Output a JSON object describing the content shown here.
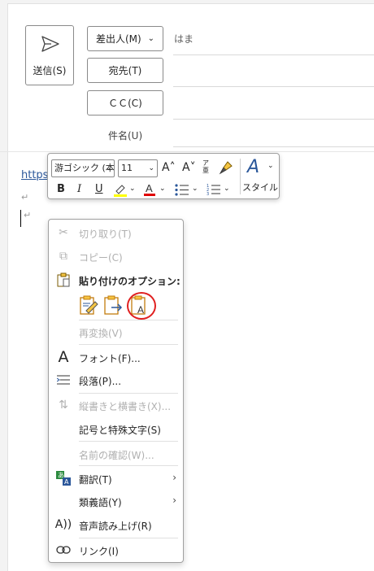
{
  "header": {
    "send_label": "送信(S)",
    "from_label": "差出人(M)",
    "from_value": "はま",
    "to_label": "宛先(T)",
    "cc_label": "ＣＣ(C)",
    "subject_label": "件名(U)"
  },
  "body": {
    "link_text": "https",
    "paragraph_mark": "↵"
  },
  "mini_toolbar": {
    "font_name": "游ゴシック (本",
    "font_size": "11",
    "grow_font": "A˄",
    "shrink_font": "A˅",
    "phonetic": "ア亜",
    "bold": "B",
    "italic": "I",
    "underline": "U",
    "style_label": "スタイル",
    "highlight_color": "#ffff00",
    "font_color": "#e00000"
  },
  "context_menu": {
    "cut": "切り取り(T)",
    "copy": "コピー(C)",
    "paste_options_label": "貼り付けのオプション:",
    "reconvert": "再変換(V)",
    "font": "フォント(F)...",
    "paragraph": "段落(P)...",
    "vertical_horizontal": "縦書きと横書き(X)...",
    "symbols": "記号と特殊文字(S)",
    "check_names": "名前の確認(W)...",
    "translate": "翻訳(T)",
    "synonyms": "類義語(Y)",
    "read_aloud": "音声読み上げ(R)",
    "link": "リンク(I)",
    "submenu_arrow": "›"
  },
  "colors": {
    "accent": "#2b579a",
    "highlight_circle": "#e02020"
  }
}
